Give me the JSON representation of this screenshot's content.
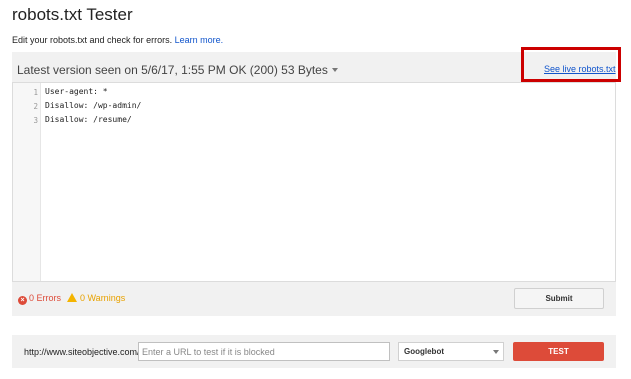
{
  "page": {
    "title": "robots.txt Tester",
    "subtitle": "Edit your robots.txt and check for errors.",
    "learn_more": "Learn more."
  },
  "editor": {
    "version_line": "Latest version seen on 5/6/17, 1:55 PM OK (200) 53 Bytes",
    "live_link": "See live robots.txt",
    "lines": [
      {
        "num": "1",
        "text": "User-agent: *"
      },
      {
        "num": "2",
        "text": "Disallow: /wp-admin/"
      },
      {
        "num": "3",
        "text": "Disallow: /resume/"
      }
    ]
  },
  "status": {
    "errors": "0 Errors",
    "warnings": "0 Warnings",
    "submit": "Submit"
  },
  "tester": {
    "base_url": "http://www.siteobjective.com/",
    "input_placeholder": "Enter a URL to test if it is blocked",
    "input_value": "",
    "bot": "Googlebot",
    "test_button": "TEST"
  },
  "colors": {
    "link": "#1155cc",
    "error": "#dd4b39",
    "warning": "#f4b400",
    "highlight": "#cc0000",
    "test_button": "#dd4b39"
  },
  "icons": {
    "error": "error-circle-icon",
    "warning": "warning-triangle-icon",
    "dropdown": "chevron-down-icon"
  }
}
